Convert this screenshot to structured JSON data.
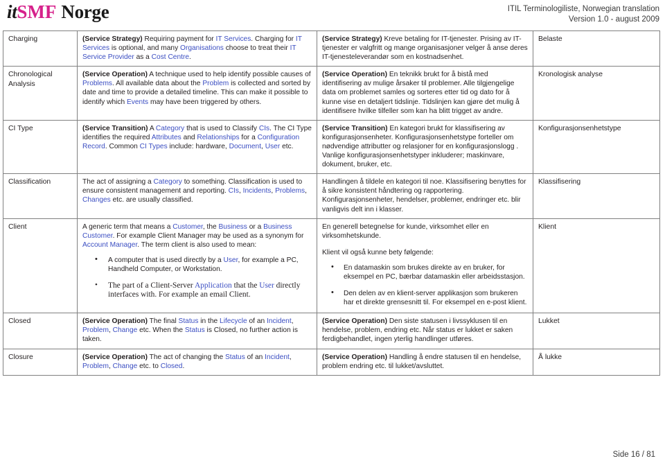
{
  "header": {
    "logo": {
      "part1": "it",
      "part2": "SMF",
      "part3": "Norge"
    },
    "title_line1": "ITIL Terminologiliste, Norwegian translation",
    "title_line2": "Version 1.0 - august 2009"
  },
  "footer": {
    "page_label": "Side 16 / 81"
  },
  "colors": {
    "link": "#3b4ec2",
    "brand_magenta": "#d6218b",
    "border": "#808080"
  },
  "table": {
    "rows": [
      {
        "term": "Charging",
        "english": {
          "context": "(Service Strategy)",
          "segments": [
            {
              "t": " Requiring payment for ",
              "link": false
            },
            {
              "t": "IT Services",
              "link": true
            },
            {
              "t": ". Charging for ",
              "link": false
            },
            {
              "t": "IT Services",
              "link": true
            },
            {
              "t": " is optional, and many ",
              "link": false
            },
            {
              "t": "Organisations",
              "link": true
            },
            {
              "t": " choose to treat their ",
              "link": false
            },
            {
              "t": "IT Service Provider",
              "link": true
            },
            {
              "t": " as a ",
              "link": false
            },
            {
              "t": "Cost Centre",
              "link": true
            },
            {
              "t": ".",
              "link": false
            }
          ]
        },
        "norwegian": {
          "context": "(Service Strategy)",
          "text": " Kreve betaling for IT-tjenester. Prising av IT-tjenester er valgfritt og mange organisasjoner velger å anse deres IT-tjenesteleverandør som en kostnadsenhet."
        },
        "norwegian_term": "Belaste"
      },
      {
        "term": "Chronological Analysis",
        "english": {
          "context": "(Service Operation)",
          "segments": [
            {
              "t": " A technique used to help identify possible causes of ",
              "link": false
            },
            {
              "t": "Problems",
              "link": true
            },
            {
              "t": ". All available data about the ",
              "link": false
            },
            {
              "t": "Problem",
              "link": true
            },
            {
              "t": " is collected and sorted by date and time to provide a detailed timeline. This can make it possible to identify which ",
              "link": false
            },
            {
              "t": "Events",
              "link": true
            },
            {
              "t": " may have been triggered by others.",
              "link": false
            }
          ]
        },
        "norwegian": {
          "context": "(Service Operation)",
          "text": " En teknikk brukt for å bistå med identifisering av mulige årsaker til problemer. Alle tilgjengelige data om problemet samles og sorteres etter tid og dato for å kunne vise en detaljert tidslinje. Tidslinjen kan gjøre det mulig å identifisere hvilke tilfeller som kan ha blitt trigget av andre."
        },
        "norwegian_term": "Kronologisk analyse"
      },
      {
        "term": "CI Type",
        "english": {
          "context": "(Service Transition)",
          "segments": [
            {
              "t": " A ",
              "link": false
            },
            {
              "t": "Category",
              "link": true
            },
            {
              "t": " that is used to Classify ",
              "link": false
            },
            {
              "t": "CIs",
              "link": true
            },
            {
              "t": ". The CI Type identifies the required ",
              "link": false
            },
            {
              "t": "Attributes",
              "link": true
            },
            {
              "t": " and ",
              "link": false
            },
            {
              "t": "Relationships",
              "link": true
            },
            {
              "t": " for a ",
              "link": false
            },
            {
              "t": "Configuration Record",
              "link": true
            },
            {
              "t": ". Common ",
              "link": false
            },
            {
              "t": "CI Types",
              "link": true
            },
            {
              "t": " include: hardware, ",
              "link": false
            },
            {
              "t": "Document",
              "link": true
            },
            {
              "t": ", ",
              "link": false
            },
            {
              "t": "User",
              "link": true
            },
            {
              "t": " etc.",
              "link": false
            }
          ]
        },
        "norwegian": {
          "context": "(Service Transition)",
          "text": " En kategori brukt for klassifisering av konfigurasjonsenheter. Konfigurasjonsenhetstype forteller om nødvendige attributter og relasjoner for en konfigurasjonslogg . Vanlige konfigurasjonsenhetstyper inkluderer; maskinvare, dokument, bruker, etc."
        },
        "norwegian_term": "Konfigurasjonsenhetstype"
      },
      {
        "term": "Classification",
        "english": {
          "context": "",
          "segments": [
            {
              "t": "The act of assigning a ",
              "link": false
            },
            {
              "t": "Category",
              "link": true
            },
            {
              "t": " to something. Classification is used to ensure consistent management and reporting. ",
              "link": false
            },
            {
              "t": "CIs",
              "link": true
            },
            {
              "t": ", ",
              "link": false
            },
            {
              "t": "Incidents",
              "link": true
            },
            {
              "t": ", ",
              "link": false
            },
            {
              "t": "Problems",
              "link": true
            },
            {
              "t": ", ",
              "link": false
            },
            {
              "t": "Changes",
              "link": true
            },
            {
              "t": " etc. are usually classified.",
              "link": false
            }
          ]
        },
        "norwegian": {
          "context": "",
          "text": "Handlingen å tildele en kategori til noe. Klassifisering benyttes for å sikre konsistent håndtering og rapportering. Konfigurasjonsenheter, hendelser, problemer, endringer etc. blir vanligvis delt inn i klasser."
        },
        "norwegian_term": "Klassifisering"
      },
      {
        "term": "Client",
        "english": {
          "context": "",
          "segments": [
            {
              "t": "A generic term that means a ",
              "link": false
            },
            {
              "t": "Customer",
              "link": true
            },
            {
              "t": ", the ",
              "link": false
            },
            {
              "t": "Business",
              "link": true
            },
            {
              "t": " or a ",
              "link": false
            },
            {
              "t": "Business Customer",
              "link": true
            },
            {
              "t": ". For example Client Manager may be used as a synonym for ",
              "link": false
            },
            {
              "t": "Account Manager",
              "link": true
            },
            {
              "t": ". The term client is also used to mean:",
              "link": false
            }
          ],
          "bullets": [
            {
              "serif": false,
              "segments": [
                {
                  "t": "A computer that is used directly by a ",
                  "link": false
                },
                {
                  "t": "User",
                  "link": true
                },
                {
                  "t": ", for example a PC, Handheld Computer, or Workstation.",
                  "link": false
                }
              ]
            },
            {
              "serif": true,
              "segments": [
                {
                  "t": "The part of a Client-Server ",
                  "link": false
                },
                {
                  "t": "Application",
                  "link": true
                },
                {
                  "t": " that the ",
                  "link": false
                },
                {
                  "t": "User",
                  "link": true
                },
                {
                  "t": " directly interfaces with. For example an email Client.",
                  "link": false
                }
              ]
            }
          ]
        },
        "norwegian": {
          "context": "",
          "text": "En generell betegnelse for kunde, virksomhet eller en virksomhetskunde.",
          "text2": "Klient vil også kunne bety følgende:",
          "bullets": [
            "En datamaskin som brukes direkte av en bruker, for eksempel en PC, bærbar datamaskin eller arbeidsstasjon.",
            "Den delen av en klient-server applikasjon som brukeren har et direkte grensesnitt til. For eksempel en e-post klient."
          ]
        },
        "norwegian_term": "Klient"
      },
      {
        "term": "Closed",
        "english": {
          "context": "(Service Operation)",
          "segments": [
            {
              "t": " The final ",
              "link": false
            },
            {
              "t": "Status",
              "link": true
            },
            {
              "t": " in the ",
              "link": false
            },
            {
              "t": "Lifecycle",
              "link": true
            },
            {
              "t": " of an ",
              "link": false
            },
            {
              "t": "Incident",
              "link": true
            },
            {
              "t": ", ",
              "link": false
            },
            {
              "t": "Problem",
              "link": true
            },
            {
              "t": ", ",
              "link": false
            },
            {
              "t": "Change",
              "link": true
            },
            {
              "t": " etc. When the ",
              "link": false
            },
            {
              "t": "Status",
              "link": true
            },
            {
              "t": " is Closed, no further action is taken.",
              "link": false
            }
          ]
        },
        "norwegian": {
          "context": "(Service Operation)",
          "text": " Den siste statusen i livssyklusen til en hendelse, problem, endring etc. Når status er lukket er saken ferdigbehandlet, ingen yterlig handlinger utføres."
        },
        "norwegian_term": "Lukket"
      },
      {
        "term": "Closure",
        "english": {
          "context": "(Service Operation)",
          "segments": [
            {
              "t": " The act of changing the ",
              "link": false
            },
            {
              "t": "Status",
              "link": true
            },
            {
              "t": " of an ",
              "link": false
            },
            {
              "t": "Incident",
              "link": true
            },
            {
              "t": ", ",
              "link": false
            },
            {
              "t": "Problem",
              "link": true
            },
            {
              "t": ", ",
              "link": false
            },
            {
              "t": "Change",
              "link": true
            },
            {
              "t": " etc. to ",
              "link": false
            },
            {
              "t": "Closed",
              "link": true
            },
            {
              "t": ".",
              "link": false
            }
          ]
        },
        "norwegian": {
          "context": "(Service Operation)",
          "text": " Handling å endre statusen til en hendelse, problem endring etc. til lukket/avsluttet."
        },
        "norwegian_term": "Å lukke"
      }
    ]
  }
}
